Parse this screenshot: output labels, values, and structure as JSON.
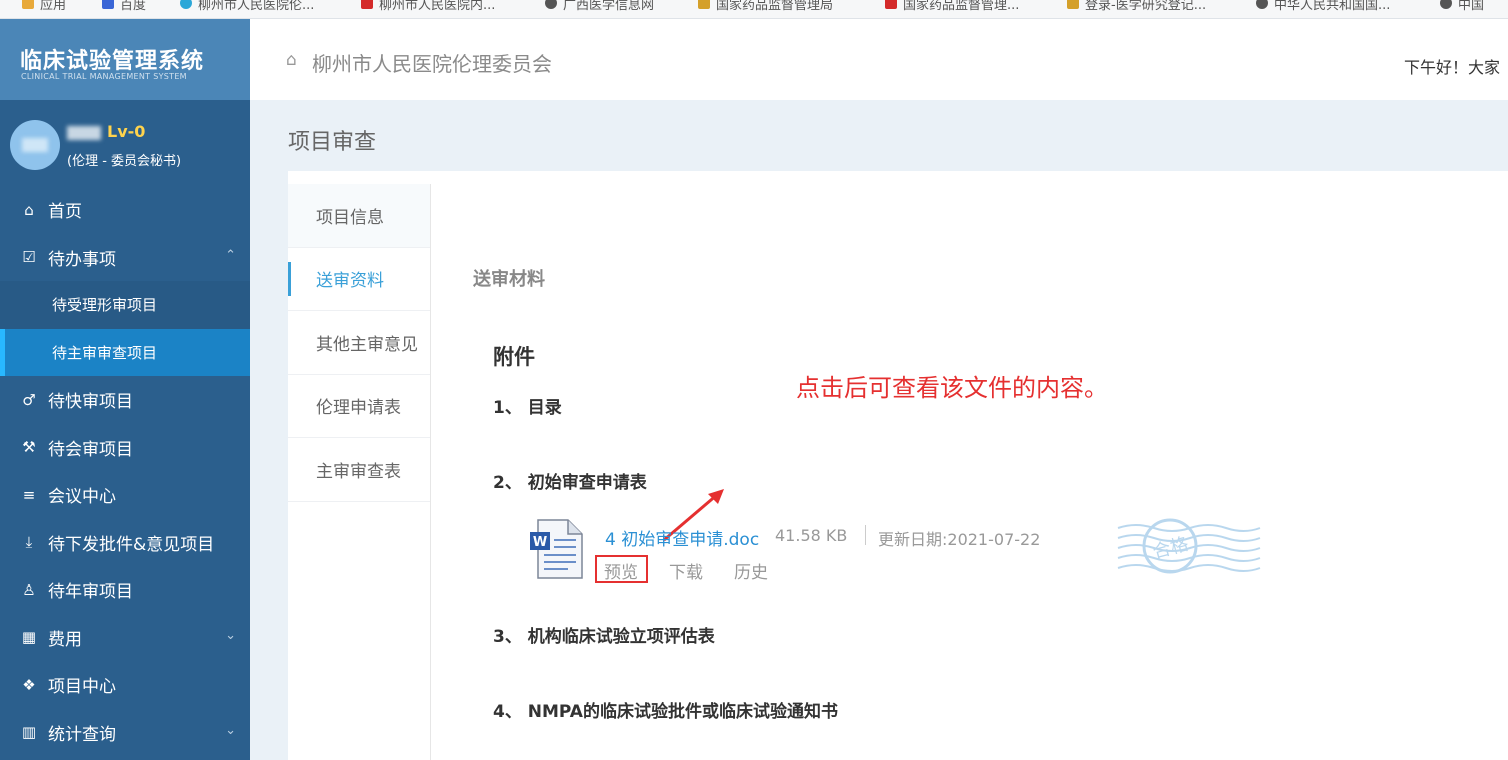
{
  "bookmarks": [
    {
      "label": "应用",
      "color": "#e8a93a"
    },
    {
      "label": "百度",
      "color": "#3a66d6"
    },
    {
      "label": "柳州市人民医院伦...",
      "color": "#2ba7d8"
    },
    {
      "label": "柳州市人民医院内...",
      "color": "#d42a2a"
    },
    {
      "label": "广西医学信息网",
      "color": "#555555"
    },
    {
      "label": "国家药品监督管理局",
      "color": "#d4a02a"
    },
    {
      "label": "国家药品监督管理...",
      "color": "#d42a2a"
    },
    {
      "label": "登录-医学研究登记...",
      "color": "#d4a02a"
    },
    {
      "label": "中华人民共和国国...",
      "color": "#555555"
    },
    {
      "label": "中国",
      "color": "#555555"
    }
  ],
  "sidebar": {
    "logo_title": "临床试验管理系统",
    "logo_subtitle": "CLINICAL TRIAL MANAGEMENT SYSTEM",
    "user_level": "Lv-0",
    "user_role": "(伦理 - 委员会秘书)",
    "items": [
      {
        "label": "首页",
        "icon": "home-icon"
      },
      {
        "label": "待办事项",
        "icon": "calendar-check-icon",
        "expanded": true
      },
      {
        "label": "待受理形审项目",
        "sub": true
      },
      {
        "label": "待主审审查项目",
        "sub": true,
        "active": true
      },
      {
        "label": "待快审项目",
        "icon": "male-icon"
      },
      {
        "label": "待会审项目",
        "icon": "gavel-icon"
      },
      {
        "label": "会议中心",
        "icon": "list-icon"
      },
      {
        "label": "待下发批件&意见项目",
        "icon": "download-icon"
      },
      {
        "label": "待年审项目",
        "icon": "person-icon"
      },
      {
        "label": "费用",
        "icon": "calendar-icon",
        "collapsed": true
      },
      {
        "label": "项目中心",
        "icon": "cubes-icon"
      },
      {
        "label": "统计查询",
        "icon": "bar-chart-icon",
        "collapsed": true
      }
    ]
  },
  "header": {
    "hospital": "柳州市人民医院伦理委员会",
    "greeting": "下午好！大家"
  },
  "page_title": "项目审查",
  "tabs": [
    {
      "label": "项目信息"
    },
    {
      "label": "送审资料",
      "selected": true
    },
    {
      "label": "其他主审意见"
    },
    {
      "label": "伦理申请表"
    },
    {
      "label": "主审审查表"
    }
  ],
  "content": {
    "section_title": "送审材料",
    "attachments_title": "附件",
    "items": [
      {
        "label": "1、 目录"
      },
      {
        "label": "2、 初始审查申请表"
      },
      {
        "label": "3、 机构临床试验立项评估表"
      },
      {
        "label": "4、 NMPA的临床试验批件或临床试验通知书"
      }
    ],
    "file": {
      "name": "4 初始审查申请.doc",
      "size": "41.58 KB",
      "updated": "更新日期:2021-07-22",
      "actions": {
        "preview": "预览",
        "download": "下载",
        "history": "历史"
      }
    },
    "annotation": "点击后可查看该文件的内容。",
    "stamp_text": "合格"
  },
  "colors": {
    "sidebar_bg": "#2b5f8d",
    "active_item": "#1b83c6",
    "accent": "#3aa0d8",
    "annotation_red": "#e53030"
  }
}
